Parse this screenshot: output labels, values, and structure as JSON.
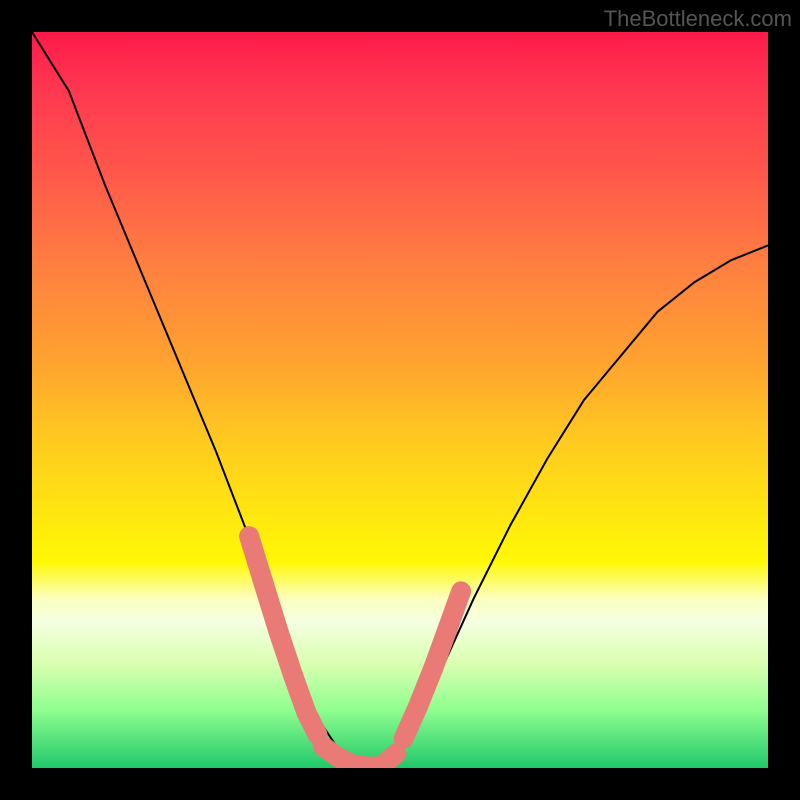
{
  "watermark": "TheBottleneck.com",
  "chart_data": {
    "type": "line",
    "title": "",
    "xlabel": "",
    "ylabel": "",
    "xlim": [
      0,
      1
    ],
    "ylim": [
      0,
      1
    ],
    "series": [
      {
        "name": "curve",
        "x": [
          0.0,
          0.05,
          0.1,
          0.15,
          0.2,
          0.25,
          0.3,
          0.34,
          0.38,
          0.42,
          0.46,
          0.5,
          0.55,
          0.6,
          0.65,
          0.7,
          0.75,
          0.8,
          0.85,
          0.9,
          0.95,
          1.0
        ],
        "y": [
          1.0,
          0.92,
          0.79,
          0.67,
          0.55,
          0.43,
          0.3,
          0.18,
          0.08,
          0.02,
          0.0,
          0.03,
          0.12,
          0.23,
          0.33,
          0.42,
          0.5,
          0.56,
          0.62,
          0.66,
          0.69,
          0.71
        ]
      }
    ],
    "highlight_segments": [
      {
        "name": "left-zone",
        "x": [
          0.295,
          0.315,
          0.335,
          0.355,
          0.373,
          0.388
        ],
        "y": [
          0.315,
          0.25,
          0.185,
          0.125,
          0.075,
          0.045
        ]
      },
      {
        "name": "bottom-zone",
        "x": [
          0.395,
          0.415,
          0.435,
          0.455,
          0.475,
          0.495
        ],
        "y": [
          0.03,
          0.015,
          0.005,
          0.002,
          0.002,
          0.02
        ]
      },
      {
        "name": "right-zone",
        "x": [
          0.505,
          0.525,
          0.545,
          0.565,
          0.583
        ],
        "y": [
          0.04,
          0.085,
          0.135,
          0.19,
          0.24
        ]
      }
    ],
    "colors": {
      "curve": "#000000",
      "highlight": "#e97a75"
    }
  }
}
